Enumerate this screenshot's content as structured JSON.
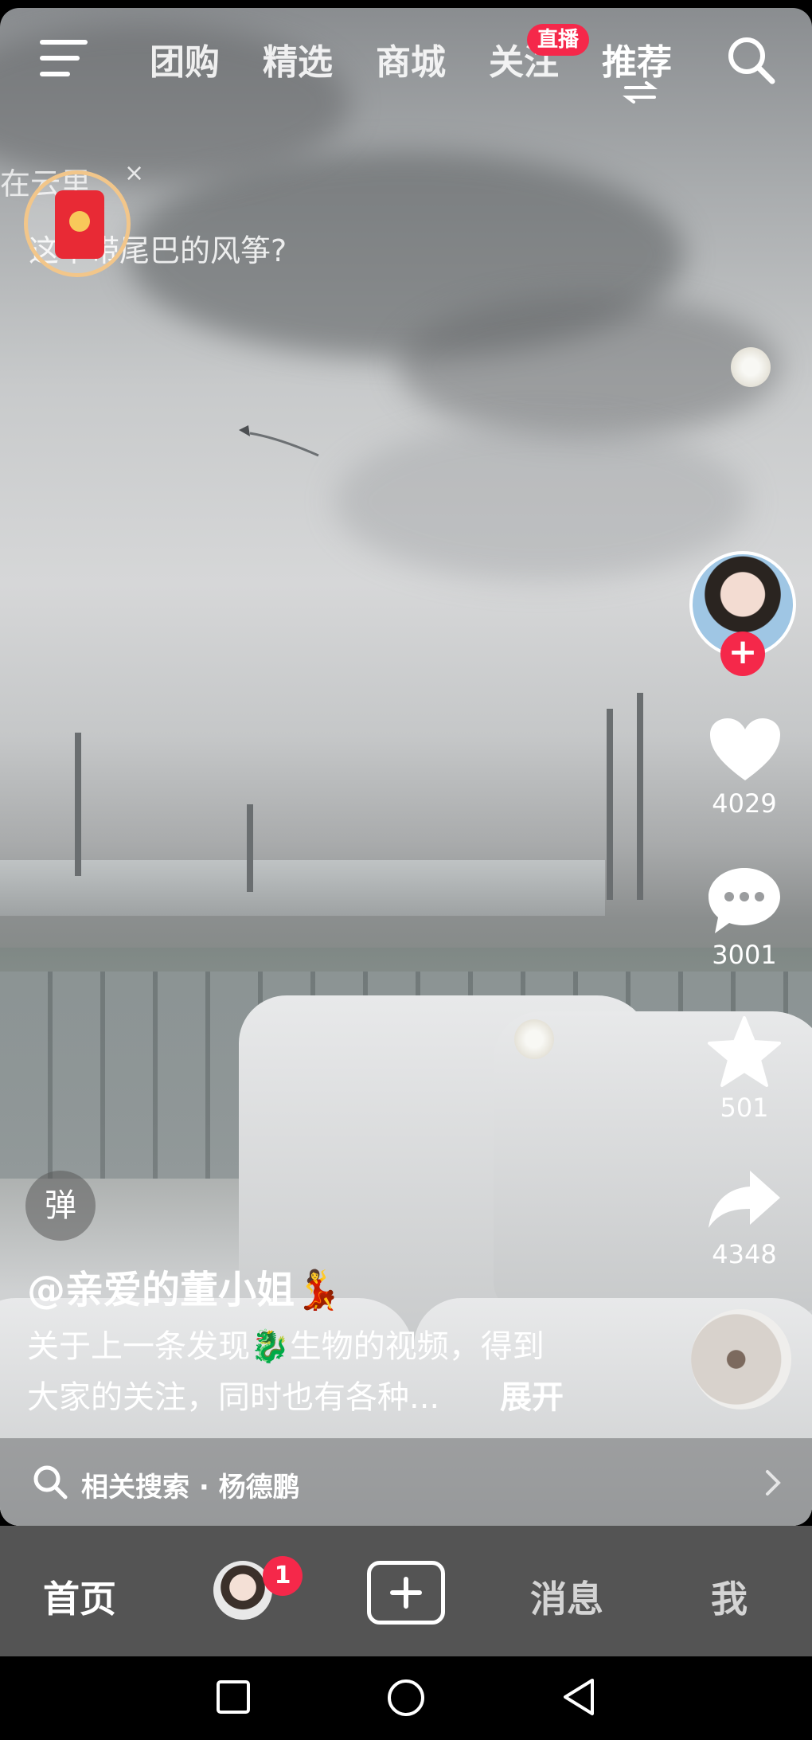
{
  "top_tabs": [
    {
      "label": "团购"
    },
    {
      "label": "精选"
    },
    {
      "label": "商城"
    },
    {
      "label": "关注"
    },
    {
      "label": "推荐"
    }
  ],
  "live_badge": "直播",
  "banner": {
    "line1": "在云里",
    "line2": "这个带尾巴的风筝?",
    "close": "×"
  },
  "actions": {
    "likes": "4029",
    "comments": "3001",
    "favorites": "501",
    "shares": "4348"
  },
  "danmu_label": "弹",
  "author": "@亲爱的董小姐💃",
  "description": {
    "line1": "关于上一条发现🐉生物的视频，得到",
    "line2": "大家的关注，同时也有各种...",
    "expand": "展开"
  },
  "related_search": "相关搜索 · 杨德鹏",
  "bottom_nav": {
    "home": "首页",
    "friends_badge": "1",
    "messages": "消息",
    "me": "我"
  },
  "colors": {
    "accent": "#f5284a",
    "nav_bg": "#545454"
  }
}
